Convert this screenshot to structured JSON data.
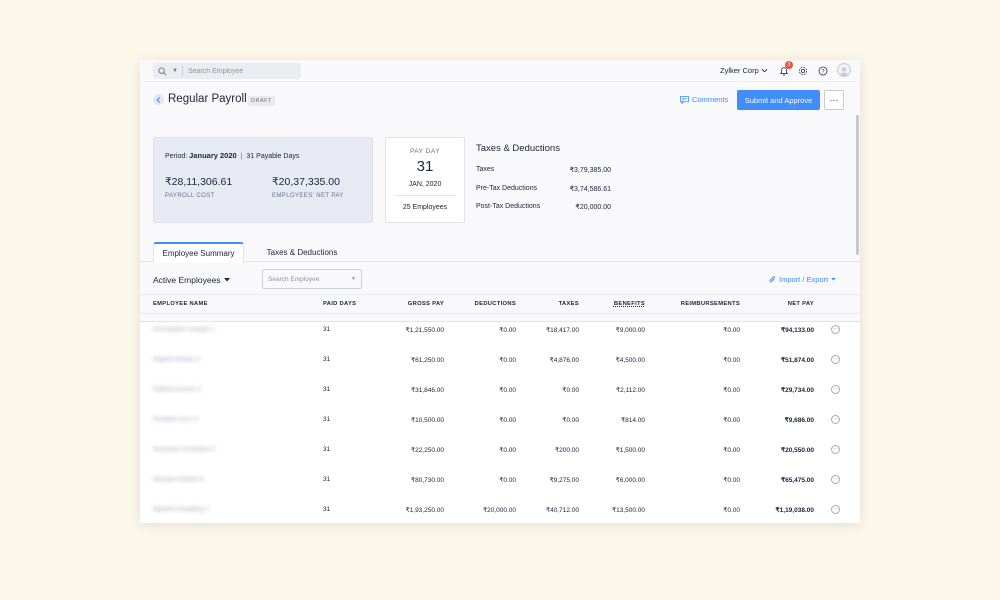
{
  "topbar": {
    "search_placeholder": "Search Employee",
    "org_name": "Zylker Corp",
    "notification_count": "3"
  },
  "header": {
    "title": "Regular Payroll",
    "status": "DRAFT",
    "comments_label": "Comments",
    "approve_label": "Submit and Approve",
    "more_label": "···"
  },
  "summary": {
    "period_prefix": "Period:",
    "period": "January 2020",
    "payable_days": "31 Payable Days",
    "payroll_cost": "₹28,11,306.61",
    "payroll_cost_label": "PAYROLL COST",
    "net_pay": "₹20,37,335.00",
    "net_pay_label": "EMPLOYEES' NET PAY"
  },
  "payday": {
    "label": "PAY DAY",
    "day": "31",
    "month_year": "JAN, 2020",
    "employees": "25 Employees"
  },
  "taxes_deductions": {
    "title": "Taxes & Deductions",
    "items": [
      {
        "label": "Taxes",
        "value": "₹3,79,385.00"
      },
      {
        "label": "Pre-Tax Deductions",
        "value": "₹3,74,586.61"
      },
      {
        "label": "Post-Tax Deductions",
        "value": "₹20,000.00"
      }
    ]
  },
  "tabs": [
    {
      "label": "Employee Summary",
      "active": true
    },
    {
      "label": "Taxes & Deductions",
      "active": false
    }
  ],
  "filter": {
    "label": "Active Employees",
    "search_placeholder": "Search Employee",
    "import_export": "Import / Export"
  },
  "table": {
    "columns": [
      "EMPLOYEE NAME",
      "PAID DAYS",
      "GROSS PAY",
      "DEDUCTIONS",
      "TAXES",
      "BENEFITS",
      "REIMBURSEMENTS",
      "NET PAY"
    ],
    "rows": [
      {
        "name": "Christopher Joseph 1",
        "paid_days": "31",
        "gross": "₹1,21,550.00",
        "deductions": "₹0.00",
        "taxes": "₹18,417.00",
        "benefits": "₹9,000.00",
        "reimbursements": "₹0.00",
        "net": "₹94,133.00"
      },
      {
        "name": "Rajesh Mohan 2",
        "paid_days": "31",
        "gross": "₹61,250.00",
        "deductions": "₹0.00",
        "taxes": "₹4,876.00",
        "benefits": "₹4,500.00",
        "reimbursements": "₹0.00",
        "net": "₹51,874.00"
      },
      {
        "name": "Sathish Kumar 3",
        "paid_days": "31",
        "gross": "₹31,846.00",
        "deductions": "₹0.00",
        "taxes": "₹0.00",
        "benefits": "₹2,112.00",
        "reimbursements": "₹0.00",
        "net": "₹29,734.00"
      },
      {
        "name": "Pandian Arun 4",
        "paid_days": "31",
        "gross": "₹10,500.00",
        "deductions": "₹0.00",
        "taxes": "₹0.00",
        "benefits": "₹814.00",
        "reimbursements": "₹0.00",
        "net": "₹9,686.00"
      },
      {
        "name": "Kumaran Chandran 5",
        "paid_days": "31",
        "gross": "₹22,250.00",
        "deductions": "₹0.00",
        "taxes": "₹200.00",
        "benefits": "₹1,500.00",
        "reimbursements": "₹0.00",
        "net": "₹20,550.00"
      },
      {
        "name": "Gautam Karthik 6",
        "paid_days": "31",
        "gross": "₹80,730.00",
        "deductions": "₹0.00",
        "taxes": "₹9,275.00",
        "benefits": "₹6,000.00",
        "reimbursements": "₹0.00",
        "net": "₹65,475.00"
      },
      {
        "name": "Manish Chowdhry 7",
        "paid_days": "31",
        "gross": "₹1,93,250.00",
        "deductions": "₹20,000.00",
        "taxes": "₹40,712.00",
        "benefits": "₹13,500.00",
        "reimbursements": "₹0.00",
        "net": "₹1,19,038.00"
      }
    ]
  },
  "colors": {
    "accent": "#408dfb",
    "badge": "#e8543e",
    "page_bg": "#fbf7e9"
  }
}
